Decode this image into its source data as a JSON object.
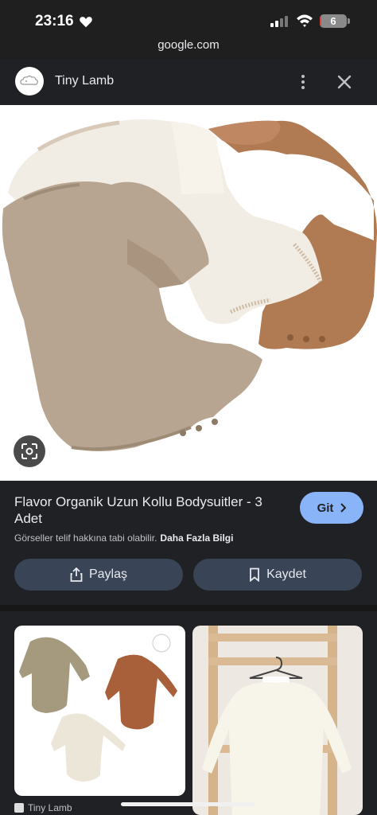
{
  "status_bar": {
    "time": "23:16",
    "battery": "6",
    "battery_level": 0.06
  },
  "url": "google.com",
  "header": {
    "site_name": "Tiny Lamb"
  },
  "result": {
    "title": "Flavor Organik Uzun Kollu Bodysuitler - 3 Adet",
    "go_label": "Git",
    "copyright_notice": "Görseller telif hakkına tabi olabilir.",
    "more_info_link": "Daha Fazla Bilgi",
    "share_label": "Paylaş",
    "save_label": "Kaydet"
  },
  "related": {
    "source_name": "Tiny Lamb"
  },
  "colors": {
    "accent": "#8ab4f8",
    "button_bg": "#394457",
    "panel_bg": "#202124",
    "battery_low": "#e0443a"
  },
  "icons": [
    "heart-icon",
    "signal-icon",
    "wifi-icon",
    "battery-icon",
    "more-vert-icon",
    "close-icon",
    "lens-icon",
    "chevron-right-icon",
    "share-icon",
    "bookmark-icon"
  ]
}
